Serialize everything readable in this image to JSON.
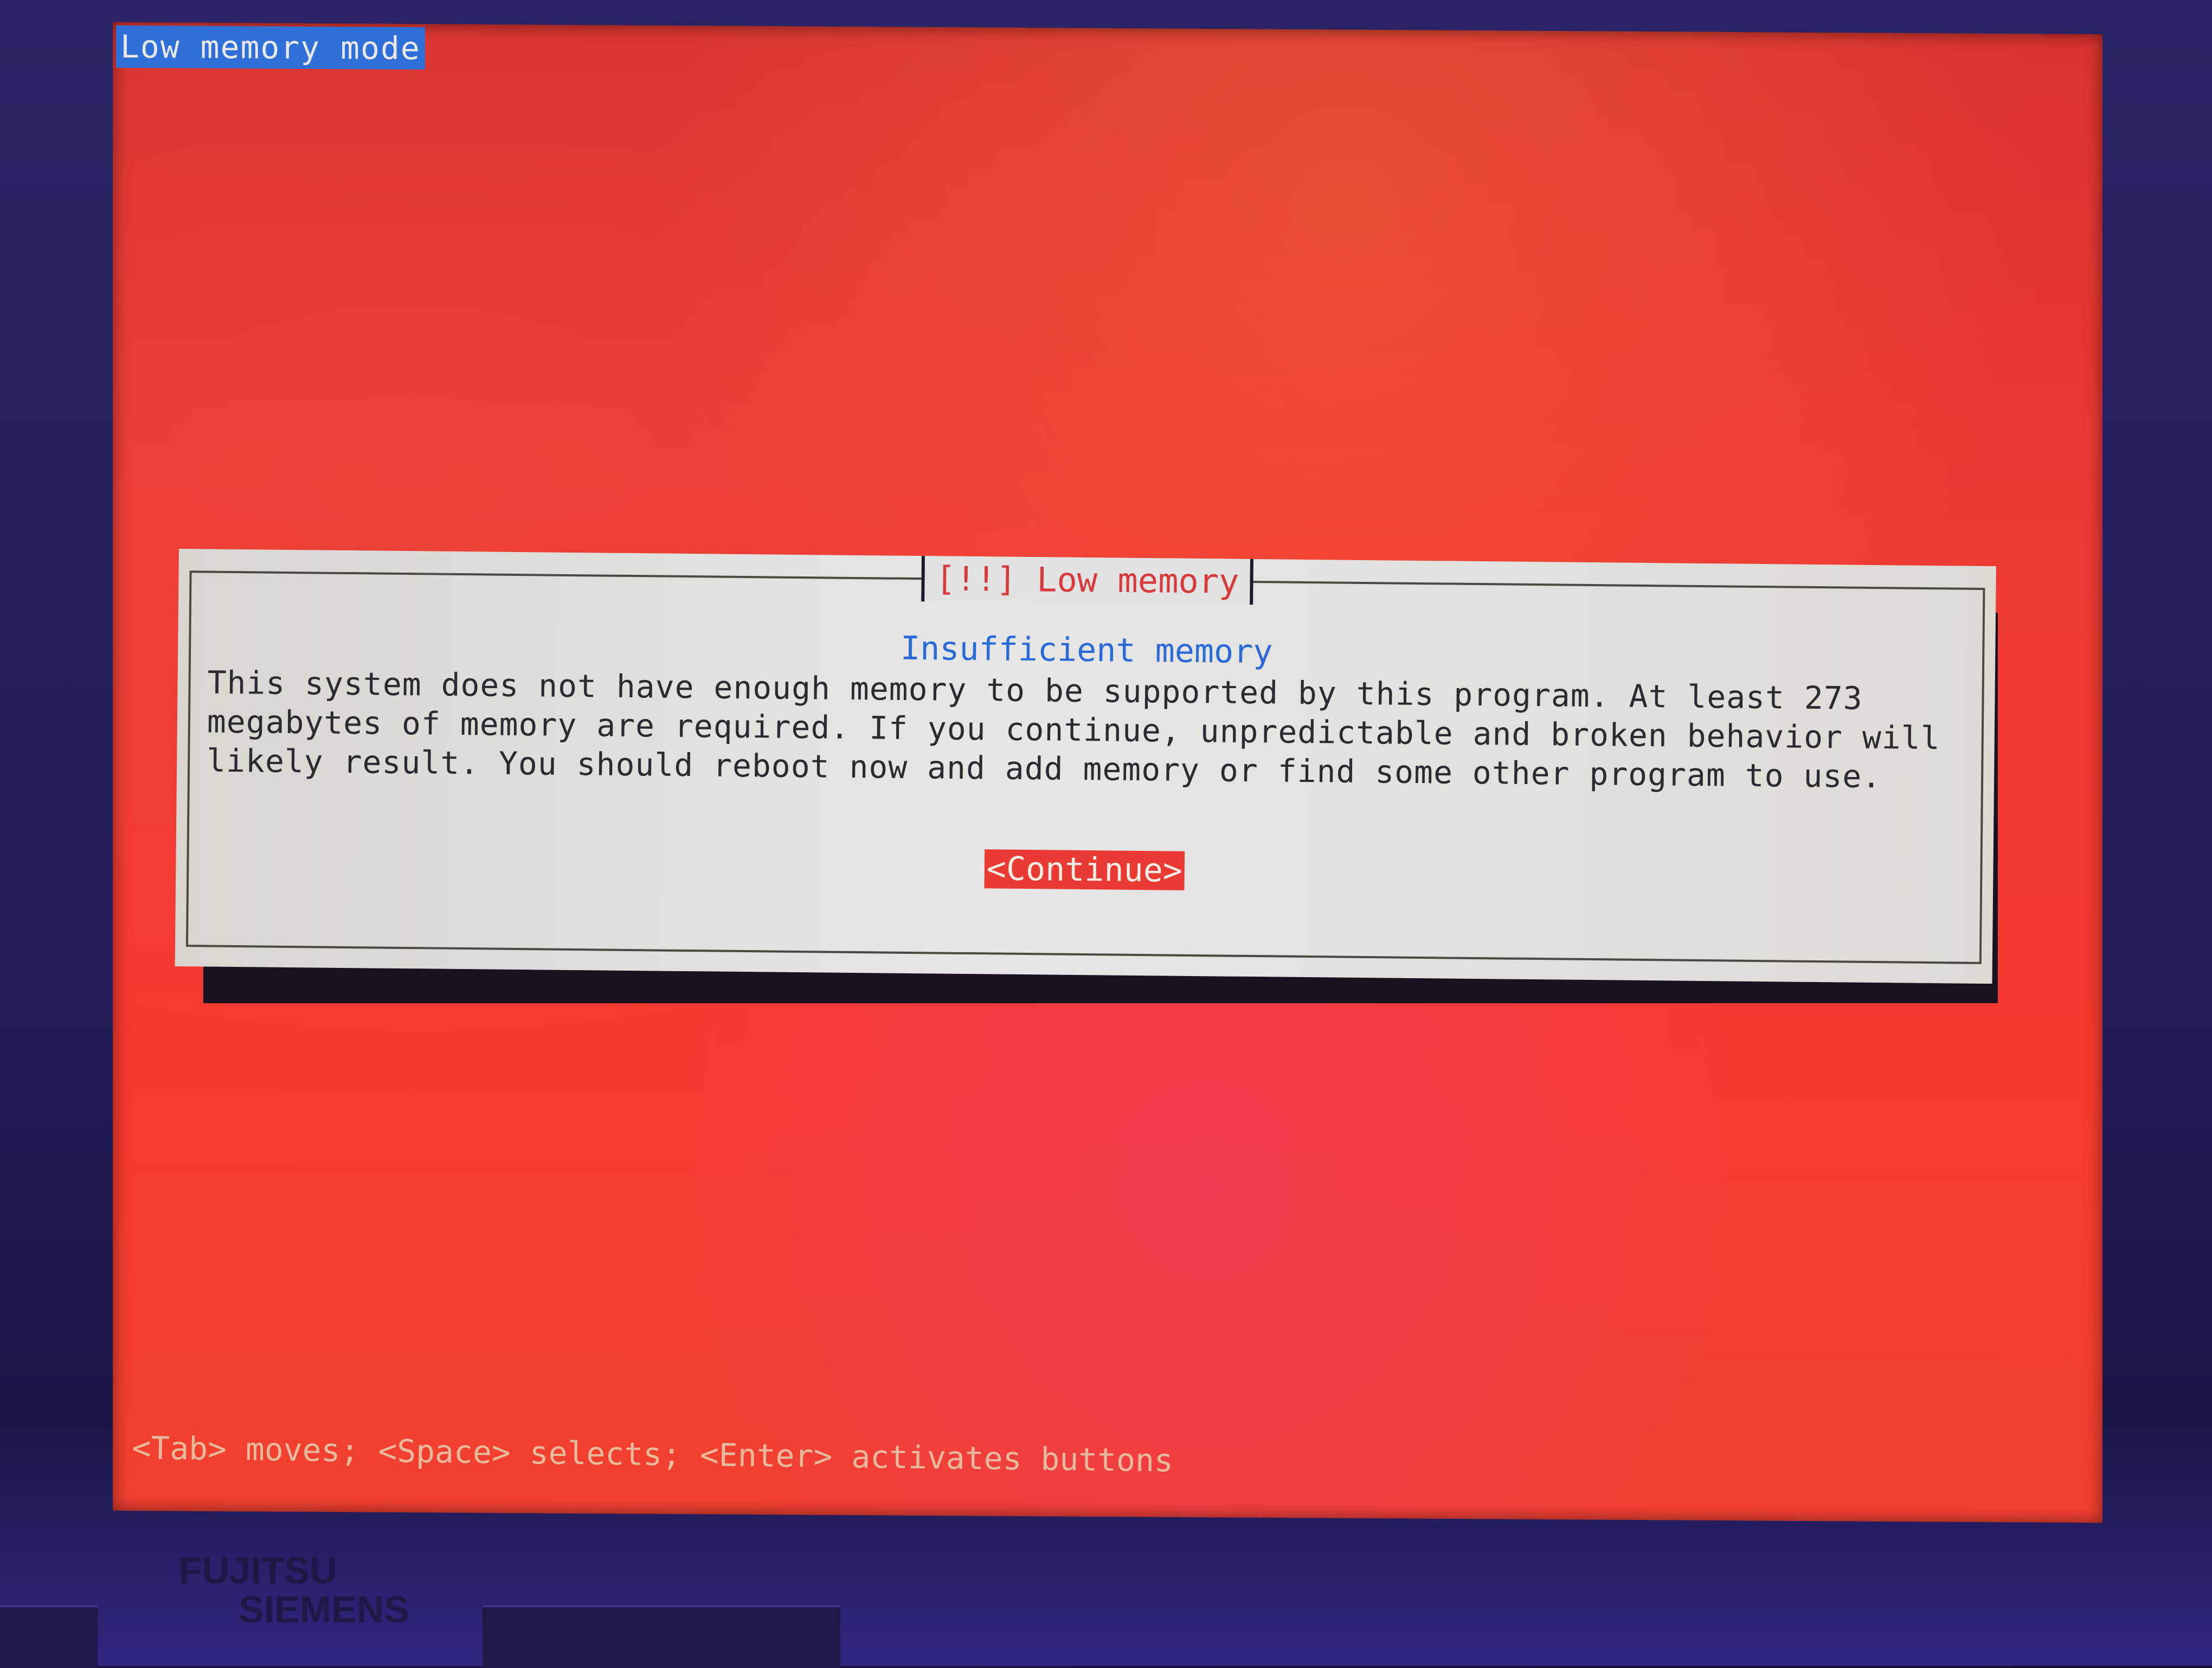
{
  "screen": {
    "title": "Low memory mode"
  },
  "dialog": {
    "title": "[!!] Low memory",
    "heading": "Insufficient memory",
    "body_lines": [
      "This system does not have enough memory to be supported by this program. At least 273",
      "megabytes of memory are required. If you continue, unpredictable and broken behavior will",
      "likely result. You should reboot now and add memory or find some other program to use."
    ],
    "continue_label": "<Continue>"
  },
  "help_line": "<Tab> moves; <Space> selects; <Enter> activates buttons",
  "bezel": {
    "brand_line1": "FUJITSU",
    "brand_line2": "SIEMENS"
  },
  "colors": {
    "background_red": "#f0392f",
    "dialog_bg": "#e2e2e2",
    "title_red": "#d8393a",
    "heading_blue": "#2a6ad8",
    "title_bar_blue": "#2f6fd8",
    "button_red": "#ea3a34"
  }
}
